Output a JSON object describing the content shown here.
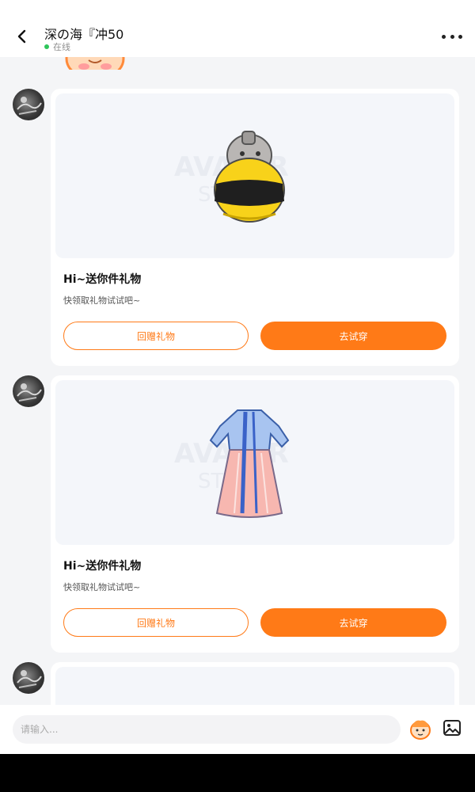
{
  "header": {
    "contact_name": "深の海『冲50",
    "status": "在线"
  },
  "messages": [
    {
      "title": "Hi~送你件礼物",
      "subtitle": "快领取礼物试试吧~",
      "gift_icon": "bee-plush-icon"
    },
    {
      "title": "Hi~送你件礼物",
      "subtitle": "快领取礼物试试吧~",
      "gift_icon": "hanfu-dress-icon"
    }
  ],
  "buttons": {
    "return_gift": "回赠礼物",
    "try_on": "去试穿"
  },
  "input": {
    "placeholder": "请输入..."
  },
  "icons": {
    "back": "chevron-left-icon",
    "more": "more-dots-icon",
    "sticker": "sticker-face-icon",
    "image": "image-icon"
  },
  "colors": {
    "accent": "#ff7a17",
    "online": "#2ec55a",
    "background": "#f4f5f7"
  }
}
